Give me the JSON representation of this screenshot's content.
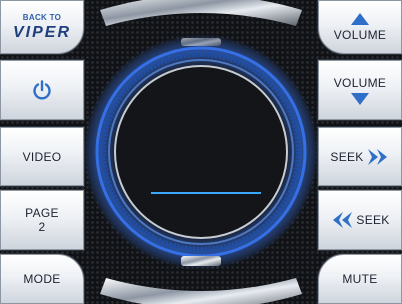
{
  "left_buttons": {
    "back": {
      "line1": "BACK TO",
      "line2": "VIPER"
    },
    "power": {
      "icon": "power-icon"
    },
    "video": {
      "label": "VIDEO"
    },
    "page": {
      "line1": "PAGE",
      "line2": "2"
    },
    "mode": {
      "label": "MODE"
    }
  },
  "right_buttons": {
    "volume_up": {
      "label": "VOLUME",
      "icon": "arrow-up-icon"
    },
    "volume_down": {
      "label": "VOLUME",
      "icon": "arrow-down-icon"
    },
    "seek_forward": {
      "label": "SEEK",
      "icon": "double-chevron-right-icon"
    },
    "seek_back": {
      "label": "SEEK",
      "icon": "double-chevron-left-icon"
    },
    "mute": {
      "label": "MUTE"
    }
  },
  "colors": {
    "accent_blue": "#2f6fc8",
    "glow_blue": "#3a7bff",
    "button_text": "#1d2230",
    "display_bg": "#141519"
  }
}
